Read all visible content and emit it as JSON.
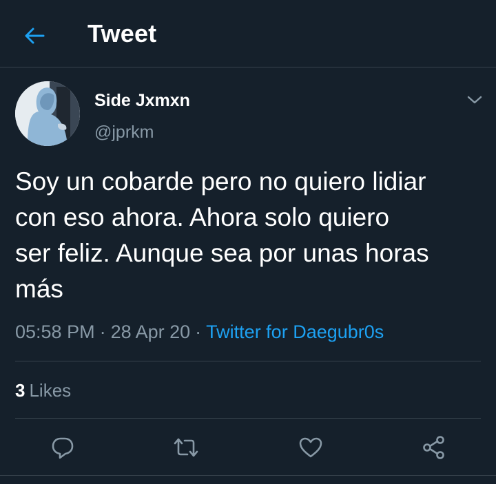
{
  "header": {
    "title": "Tweet",
    "back_icon": "arrow-left-icon"
  },
  "tweet": {
    "display_name": "Side Jxmxn",
    "handle": "@jprkm",
    "text": "Soy un cobarde pero no quiero lidiar\ncon eso ahora. Ahora solo quiero\nser feliz. Aunque sea por unas horas\nmás",
    "time": "05:58 PM",
    "date": "28 Apr 20",
    "separator": "·",
    "source": "Twitter for Daegubr0s",
    "likes_count": "3",
    "likes_label": "Likes"
  },
  "actions": [
    "reply-icon",
    "retweet-icon",
    "like-icon",
    "share-icon"
  ],
  "colors": {
    "background": "#15202b",
    "accent": "#1da1f2",
    "secondary_text": "#8899a6",
    "divider": "#38444d"
  }
}
